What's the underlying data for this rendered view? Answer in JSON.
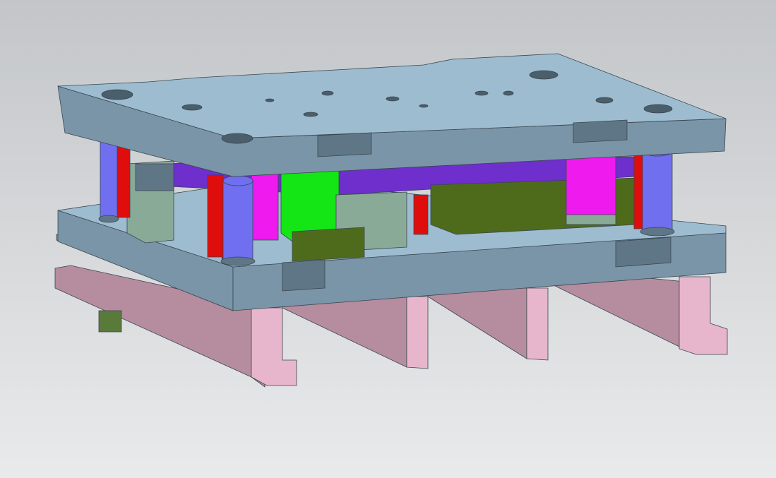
{
  "viewport": {
    "background_top": "#c3c6c9",
    "background_bottom": "#e9eaeb"
  },
  "model": {
    "colors": {
      "plate_top": "#9dbcd0",
      "plate_side": "#7a95a7",
      "plate_edge": "#5f7686",
      "hole": "#4a5e6b",
      "riser": "#e8b6cc",
      "riser_shade": "#b58d9e",
      "pillar": "#6f6ff0",
      "spring": "#e00d0d",
      "pad": "#ee1aee",
      "insert_green": "#13e614",
      "block_olive": "#4e6b1c",
      "block_grey": "#8aaa98",
      "stripper": "#6e2fcc",
      "label_tag": "#5a7a3a"
    }
  }
}
